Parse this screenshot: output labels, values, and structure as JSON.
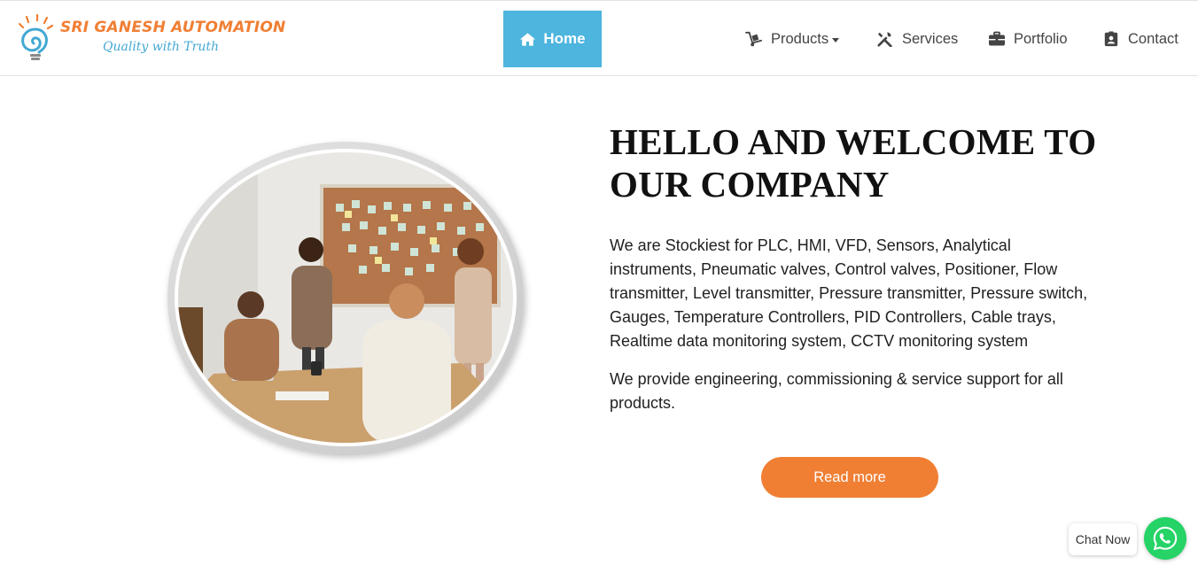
{
  "brand": {
    "name": "SRI GANESH AUTOMATION",
    "tagline": "Quality with Truth",
    "colors": {
      "orange": "#f07f34",
      "blue": "#4db5de"
    }
  },
  "nav": {
    "home": {
      "label": "Home",
      "icon": "home-icon"
    },
    "products": {
      "label": "Products",
      "icon": "hand-truck-icon"
    },
    "services": {
      "label": "Services",
      "icon": "tools-icon"
    },
    "portfolio": {
      "label": "Portfolio",
      "icon": "briefcase-icon"
    },
    "contact": {
      "label": "Contact",
      "icon": "id-badge-icon"
    }
  },
  "hero": {
    "title_line1": "HELLO AND WELCOME TO",
    "title_line2": "OUR COMPANY",
    "paragraph1": "We are Stockiest for PLC, HMI, VFD, Sensors, Analytical instruments, Pneumatic valves, Control valves, Positioner, Flow transmitter, Level transmitter, Pressure transmitter, Pressure switch, Gauges, Temperature Controllers, PID Controllers, Cable trays, Realtime data monitoring system, CCTV monitoring system",
    "paragraph2": "We provide engineering, commissioning & service support for all products.",
    "button_label": "Read more"
  },
  "chat": {
    "label": "Chat Now",
    "icon": "whatsapp-icon",
    "color": "#25d366"
  }
}
